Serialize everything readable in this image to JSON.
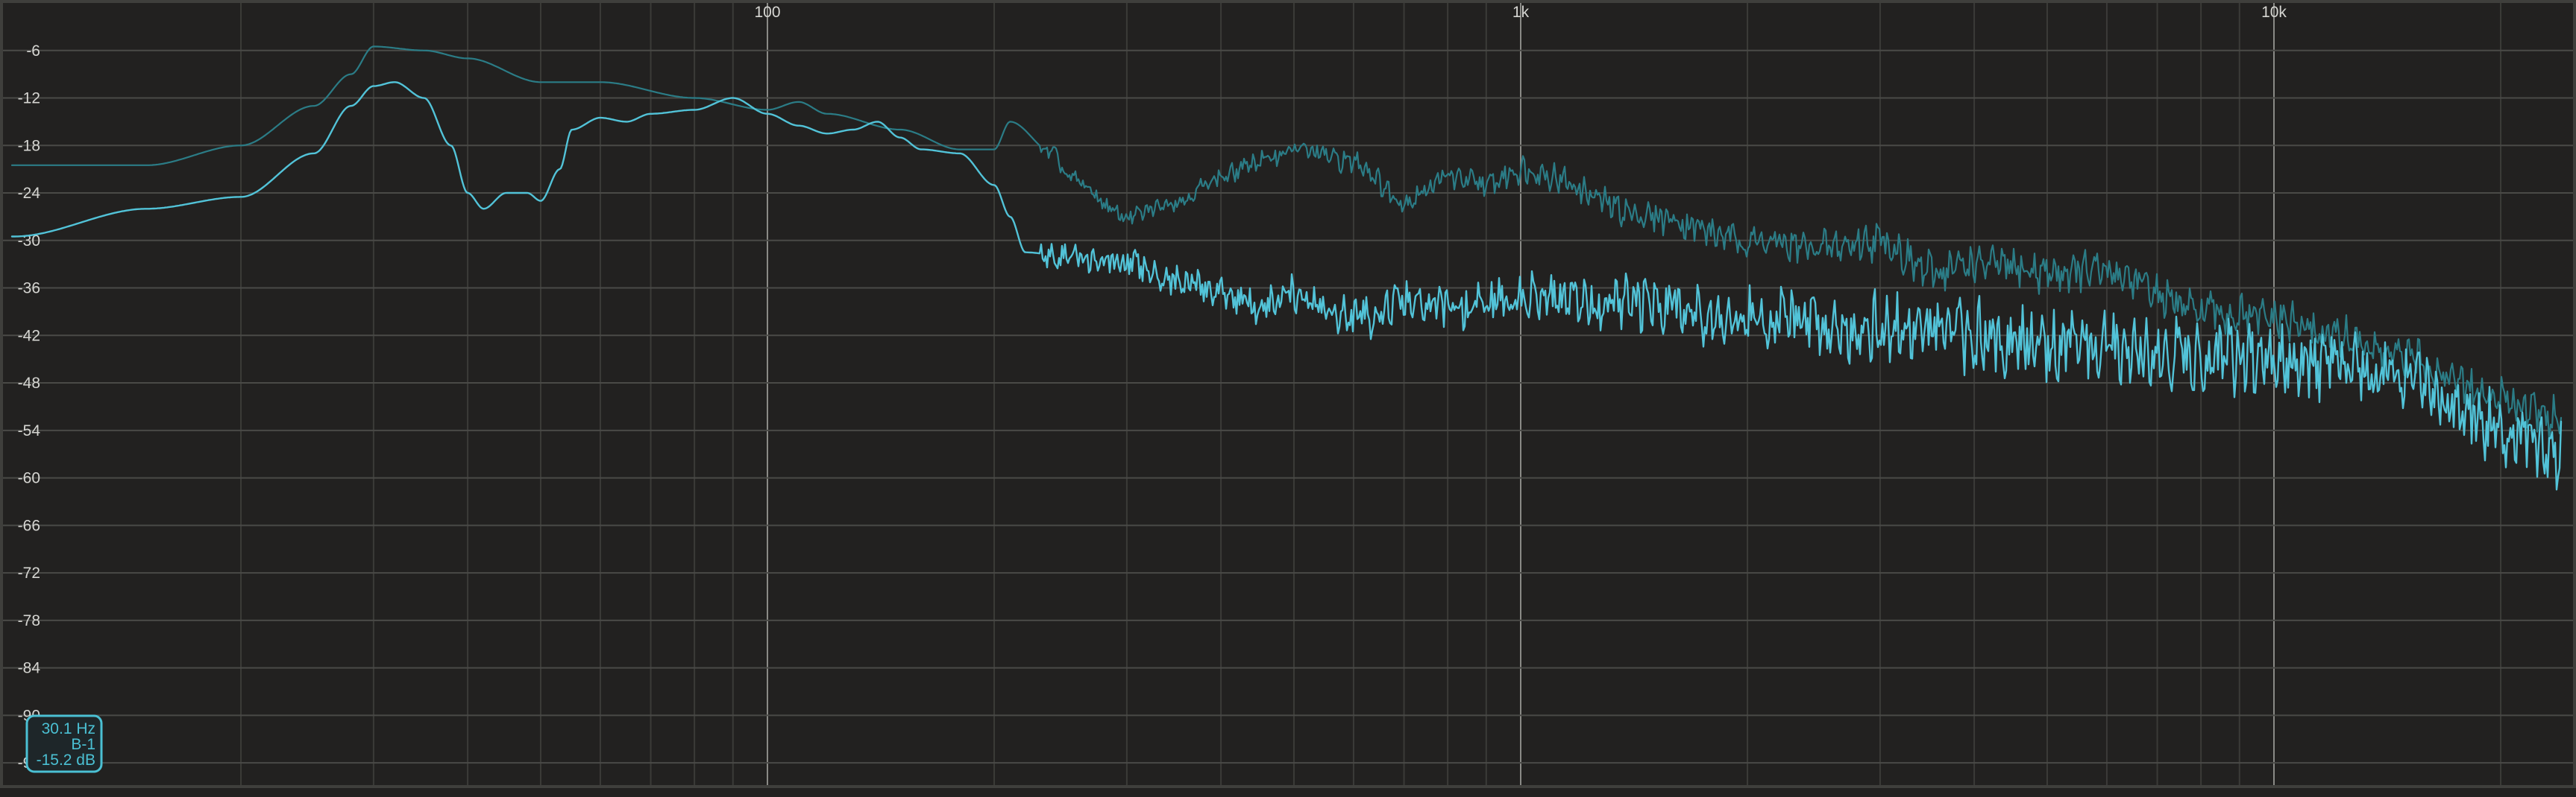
{
  "chart_data": {
    "type": "line",
    "title": "",
    "xlabel": "",
    "ylabel": "",
    "x_scale": "log",
    "xlim": [
      10,
      34000
    ],
    "ylim": [
      -99,
      0
    ],
    "grid": true,
    "x_tick_labels": [
      {
        "value": 100,
        "label": "100"
      },
      {
        "value": 1000,
        "label": "1k"
      },
      {
        "value": 10000,
        "label": "10k"
      }
    ],
    "y_ticks": [
      -6,
      -12,
      -18,
      -24,
      -30,
      -36,
      -42,
      -48,
      -54,
      -60,
      -66,
      -72,
      -78,
      -84,
      -90,
      -96
    ],
    "colors": {
      "background": "#222120",
      "primary": "#52c3d8",
      "secondary": "#2b7c86",
      "accent": "#4bc0d3"
    },
    "series": [
      {
        "role": "max-hold",
        "color": "#2b7c86",
        "x": [
          10,
          15,
          20,
          25,
          28,
          30,
          35,
          40,
          50,
          60,
          80,
          100,
          110,
          120,
          150,
          180,
          200,
          210,
          240,
          250,
          300,
          350,
          400,
          450,
          500,
          600,
          700,
          800,
          900,
          1000,
          1500,
          2000,
          2500,
          3000,
          3500,
          4000,
          5000,
          6000,
          8000,
          10000,
          12000,
          15000,
          20000,
          25000,
          30000,
          33000
        ],
        "y": [
          -20.5,
          -20.5,
          -18,
          -13,
          -9,
          -5.5,
          -6,
          -7,
          -10,
          -10,
          -12,
          -13.5,
          -12.5,
          -14,
          -16,
          -18.5,
          -18.5,
          -15,
          -19,
          -22,
          -27,
          -25,
          -22,
          -20,
          -18.5,
          -20,
          -25,
          -22,
          -23,
          -21,
          -27,
          -30,
          -31,
          -30,
          -34,
          -33,
          -34,
          -34,
          -39,
          -40,
          -42,
          -45,
          -50,
          -53,
          -56,
          -60
        ]
      },
      {
        "role": "realtime",
        "color": "#52c3d8",
        "x": [
          10,
          15,
          20,
          25,
          28,
          30,
          32,
          35,
          38,
          40,
          42,
          45,
          48,
          50,
          53,
          55,
          60,
          65,
          70,
          80,
          90,
          100,
          110,
          120,
          130,
          140,
          150,
          160,
          180,
          200,
          210,
          220,
          250,
          300,
          350,
          400,
          450,
          500,
          600,
          700,
          800,
          1000,
          1500,
          2000,
          3000,
          4000,
          5000,
          6000,
          8000,
          10000,
          12000,
          15000,
          18000,
          20000,
          25000,
          30000,
          33000
        ],
        "y": [
          -29.5,
          -26,
          -24.5,
          -19,
          -13,
          -10.5,
          -10,
          -12,
          -18,
          -24,
          -26,
          -24,
          -24,
          -25,
          -21,
          -16,
          -14.5,
          -15,
          -14,
          -13.5,
          -12,
          -14,
          -15.5,
          -16.5,
          -16,
          -15,
          -17,
          -18.5,
          -19,
          -23,
          -27,
          -31.5,
          -32,
          -33,
          -35,
          -36.5,
          -38.5,
          -37,
          -40,
          -38,
          -38.5,
          -37.5,
          -38,
          -40,
          -41,
          -42,
          -43,
          -43.5,
          -44.5,
          -45.5,
          -46,
          -47,
          -52,
          -54,
          -57,
          -62,
          -67
        ]
      }
    ]
  },
  "readout": {
    "frequency": "30.1 Hz",
    "note": "B-1",
    "level": "-15.2 dB"
  }
}
